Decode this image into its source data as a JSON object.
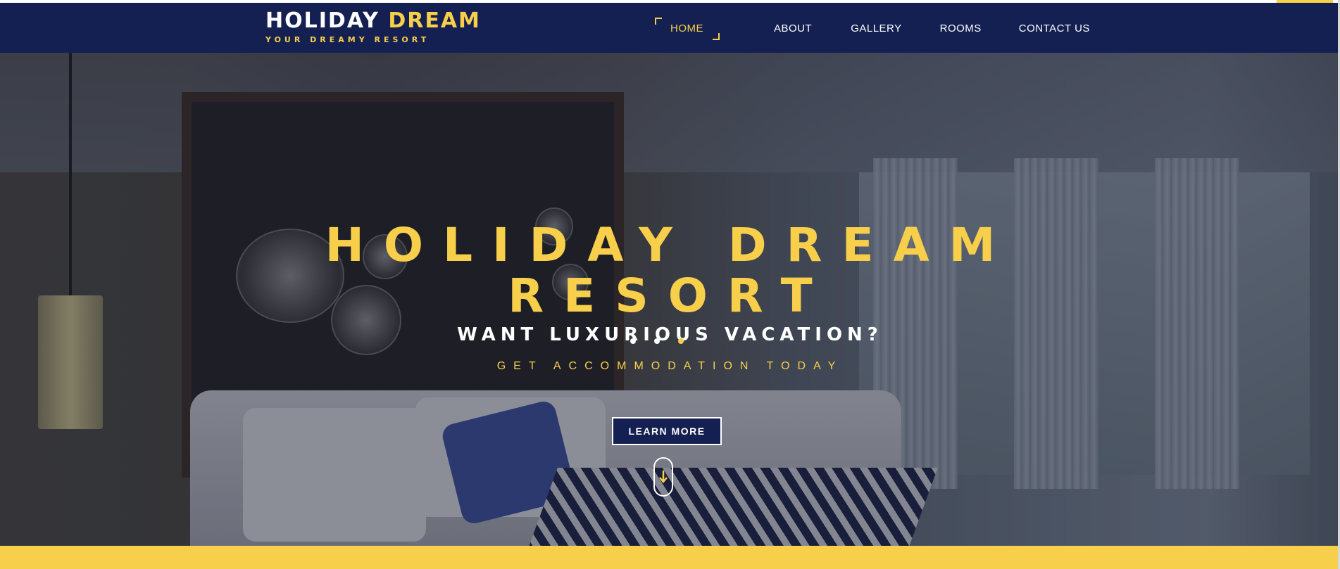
{
  "brand": {
    "title_part1": "HOLIDAY",
    "title_part2": "DREAM",
    "tagline": "YOUR DREAMY RESORT"
  },
  "nav": {
    "items": [
      {
        "label": "HOME",
        "active": true
      },
      {
        "label": "ABOUT",
        "active": false
      },
      {
        "label": "GALLERY",
        "active": false
      },
      {
        "label": "ROOMS",
        "active": false
      },
      {
        "label": "CONTACT US",
        "active": false
      }
    ]
  },
  "hero": {
    "title_line1": "HOLIDAY DREAM",
    "title_line2": "RESORT",
    "subtitle": "WANT LUXURIOUS VACATION?",
    "tagline": "GET ACCOMMODATION TODAY",
    "cta_label": "LEARN MORE",
    "slider_dots": 3,
    "active_slide": 3
  },
  "colors": {
    "navy": "#142052",
    "gold": "#f7cf4a",
    "white": "#ffffff"
  },
  "icons": {
    "scroll_down": "arrow-down-icon"
  }
}
